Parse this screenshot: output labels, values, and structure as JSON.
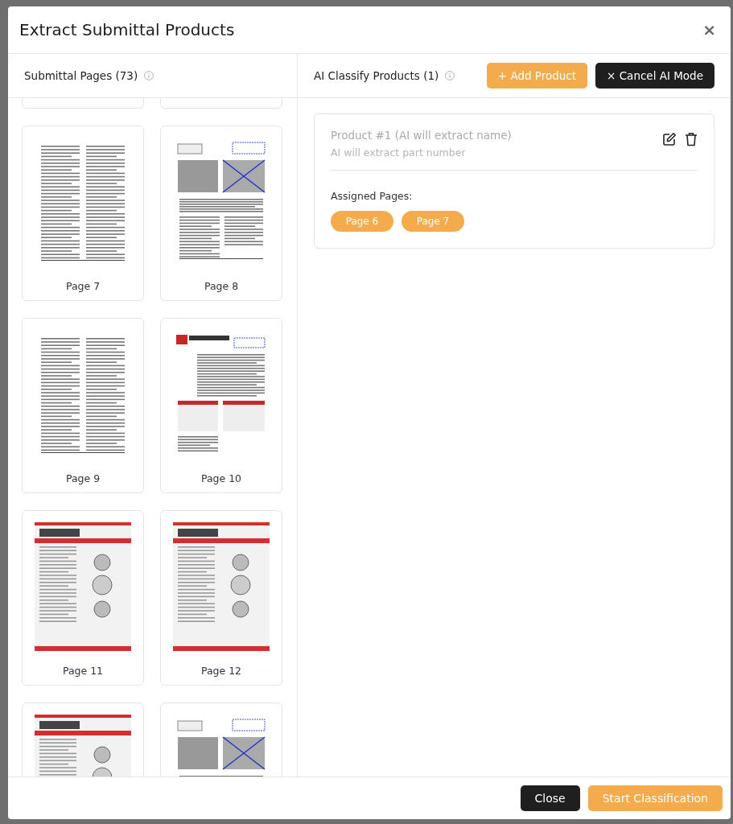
{
  "dialog": {
    "title": "Extract Submittal Products",
    "close_icon": "×"
  },
  "pages_panel": {
    "title": "Submittal Pages (73)",
    "pages": [
      {
        "kind": "blank"
      },
      {
        "kind": "blank"
      },
      {
        "kind": "text-doc",
        "label": "Page 7"
      },
      {
        "kind": "marked-doc",
        "label": "Page 8"
      },
      {
        "kind": "text-doc",
        "label": "Page 9"
      },
      {
        "kind": "brochure",
        "label": "Page 10"
      },
      {
        "kind": "red-brochure",
        "label": "Page 11"
      },
      {
        "kind": "red-brochure",
        "label": "Page 12"
      },
      {
        "kind": "red-brochure"
      },
      {
        "kind": "marked-doc"
      }
    ]
  },
  "products_panel": {
    "title": "AI Classify Products (1)",
    "add_button": "+ Add Product",
    "cancel_button": "× Cancel AI Mode",
    "products": [
      {
        "name": "Product #1 (AI will extract name)",
        "part_number": "AI will extract part number",
        "assigned_label": "Assigned Pages:",
        "pages": [
          "Page 6",
          "Page 7"
        ]
      }
    ]
  },
  "footer": {
    "buttons": [
      {
        "label": "Close",
        "kind": "dark"
      },
      {
        "label": "Start Classification",
        "kind": "primary"
      }
    ]
  }
}
